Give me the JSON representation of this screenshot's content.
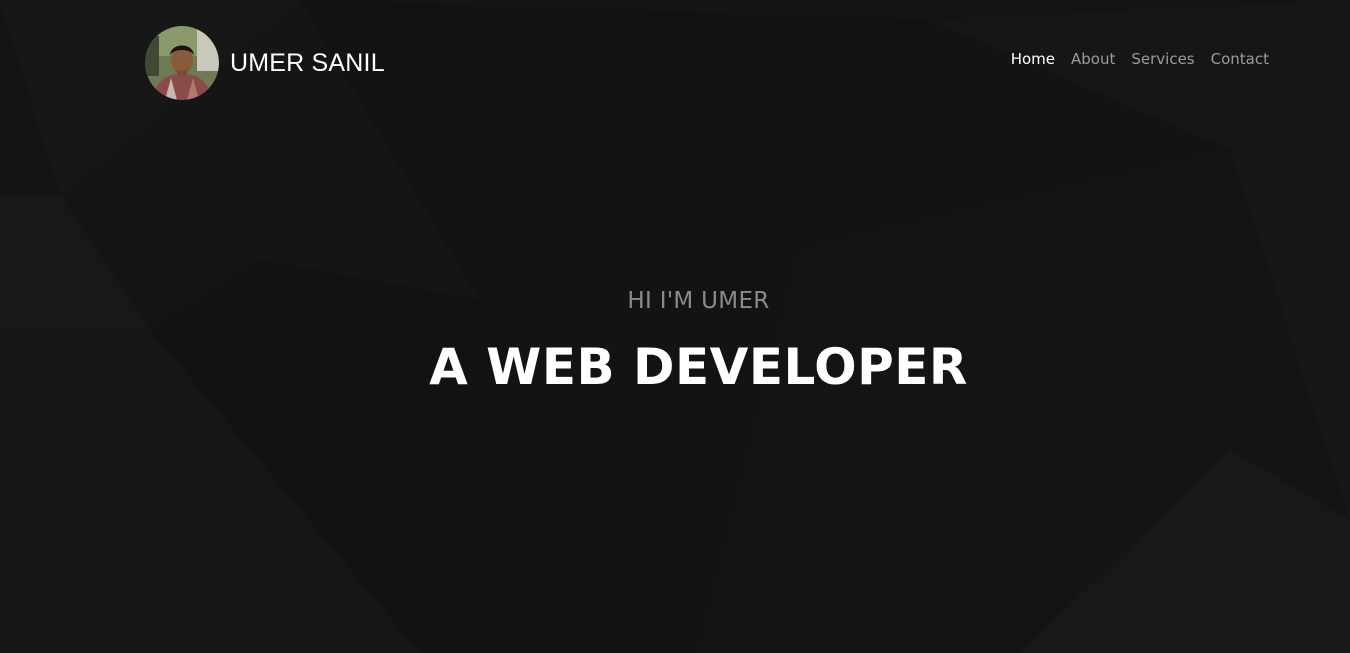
{
  "brand": {
    "name": "UMER SANIL",
    "avatar_icon": "profile-photo"
  },
  "nav": {
    "items": [
      {
        "label": "Home",
        "active": true
      },
      {
        "label": "About",
        "active": false
      },
      {
        "label": "Services",
        "active": false
      },
      {
        "label": "Contact",
        "active": false
      }
    ]
  },
  "hero": {
    "subtitle": "HI I'M UMER",
    "title": "A WEB DEVELOPER"
  },
  "colors": {
    "background": "#141414",
    "text_primary": "#ffffff",
    "text_muted": "#9c9c9c",
    "subtitle": "#8a8a8a"
  }
}
